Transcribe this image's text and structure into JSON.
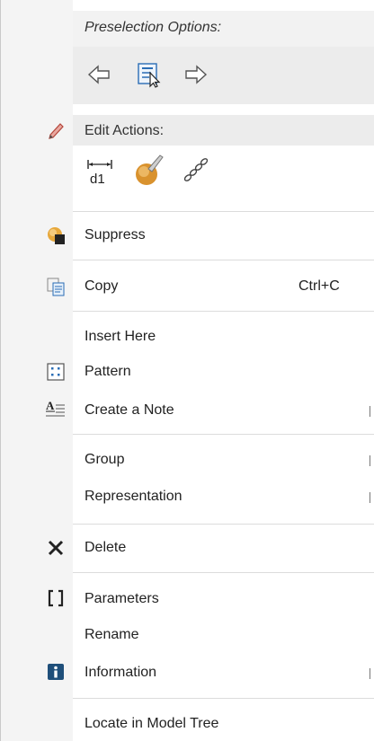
{
  "preselection": {
    "title": "Preselection Options:",
    "icons": [
      "arrow-left-icon",
      "select-cursor-icon",
      "arrow-right-icon"
    ]
  },
  "edit_actions": {
    "title": "Edit Actions:",
    "icons": [
      "dimension-d1-icon",
      "edit-definition-brush-icon",
      "chain-link-icon"
    ],
    "gutter_icon": "pencil-icon"
  },
  "items": {
    "suppress": {
      "label": "Suppress",
      "icon": "suppress-icon"
    },
    "copy": {
      "label": "Copy",
      "shortcut": "Ctrl+C",
      "icon": "copy-icon"
    },
    "insert_here": {
      "label": "Insert Here"
    },
    "pattern": {
      "label": "Pattern",
      "icon": "pattern-icon"
    },
    "create_note": {
      "label": "Create a Note",
      "icon": "note-icon"
    },
    "group": {
      "label": "Group"
    },
    "representation": {
      "label": "Representation"
    },
    "delete": {
      "label": "Delete",
      "icon": "delete-x-icon"
    },
    "parameters": {
      "label": "Parameters",
      "icon": "parameters-icon"
    },
    "rename": {
      "label": "Rename"
    },
    "information": {
      "label": "Information",
      "icon": "info-icon"
    },
    "locate": {
      "label": "Locate in Model Tree"
    }
  },
  "colors": {
    "header_bg": "#ececec",
    "separator": "#dcdcdc",
    "gutter": "#f4f4f4"
  }
}
